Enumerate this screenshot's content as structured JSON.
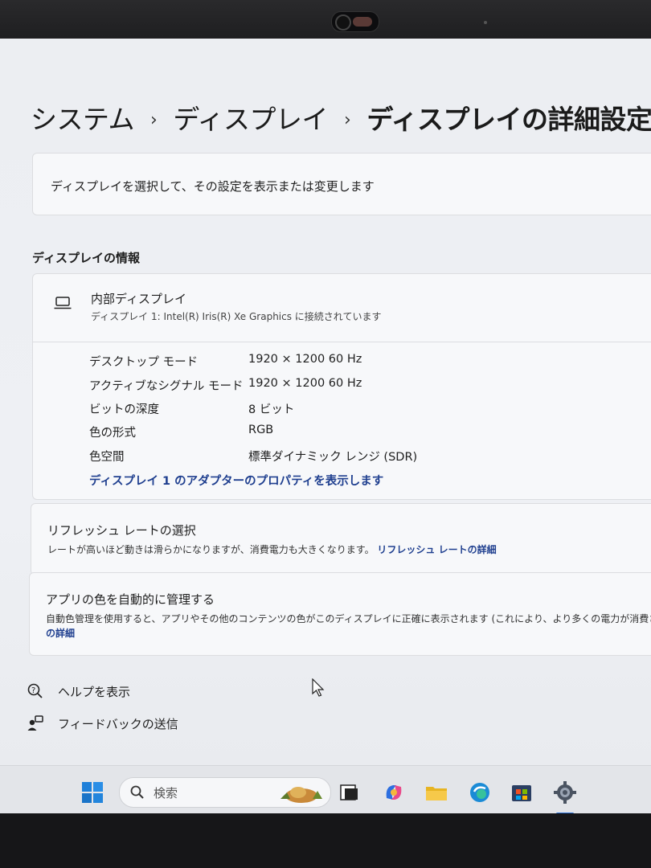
{
  "breadcrumb": {
    "item1": "システム",
    "item2": "ディスプレイ",
    "current": "ディスプレイの詳細設定",
    "separator": "›"
  },
  "select_display": {
    "text": "ディスプレイを選択して、その設定を表示または変更します"
  },
  "display_info": {
    "section_title": "ディスプレイの情報",
    "name": "内部ディスプレイ",
    "subtitle": "ディスプレイ 1: Intel(R) Iris(R) Xe Graphics に接続されています",
    "rows": [
      {
        "label": "デスクトップ モード",
        "value": "1920 × 1200 60 Hz"
      },
      {
        "label": "アクティブなシグナル モード",
        "value": "1920 × 1200 60 Hz"
      },
      {
        "label": "ビットの深度",
        "value": "8 ビット"
      },
      {
        "label": "色の形式",
        "value": "RGB"
      },
      {
        "label": "色空間",
        "value": "標準ダイナミック レンジ (SDR)"
      }
    ],
    "adapter_link": "ディスプレイ 1 のアダプターのプロパティを表示します"
  },
  "refresh_rate": {
    "title": "リフレッシュ レートの選択",
    "description": "レートが高いほど動きは滑らかになりますが、消費電力も大きくなります。",
    "link": "リフレッシュ レートの詳細"
  },
  "color_management": {
    "title": "アプリの色を自動的に管理する",
    "description": "自動色管理を使用すると、アプリやその他のコンテンツの色がこのディスプレイに正確に表示されます (これにより、より多くの電力が消費さ",
    "link": "の詳細"
  },
  "help": {
    "help_label": "ヘルプを表示",
    "feedback_label": "フィードバックの送信"
  },
  "taskbar": {
    "search_label": "検索",
    "icons": [
      "windows-start-icon",
      "search-icon",
      "weather-widget-icon",
      "task-view-icon",
      "copilot-icon",
      "file-explorer-icon",
      "edge-icon",
      "store-icon",
      "settings-icon"
    ]
  },
  "colors": {
    "accent": "#1f3f8f",
    "background": "#eceef2",
    "card": "#f7f8fa"
  }
}
